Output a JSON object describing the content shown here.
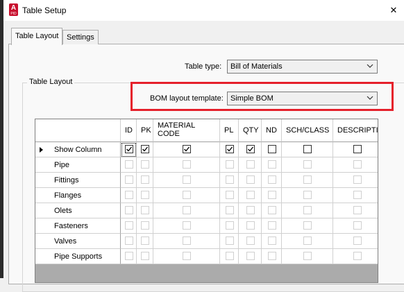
{
  "window": {
    "title": "Table Setup",
    "app_icon_letter": "A",
    "app_icon_sub": "PID"
  },
  "tabs": [
    {
      "label": "Table Layout",
      "active": true
    },
    {
      "label": "Settings",
      "active": false
    }
  ],
  "form": {
    "table_type_label": "Table type:",
    "table_type_value": "Bill of Materials",
    "group_label": "Table Layout",
    "bom_template_label": "BOM layout template:",
    "bom_template_value": "Simple BOM"
  },
  "grid": {
    "columns": [
      "ID",
      "PK",
      "MATERIAL\nCODE",
      "PL",
      "QTY",
      "ND",
      "SCH/CLASS",
      "DESCRIPTI"
    ],
    "rows": [
      {
        "label": "Show Column",
        "current": true,
        "checks": [
          "on",
          "on",
          "on",
          "on",
          "on",
          "blank",
          "blank",
          "blank"
        ]
      },
      {
        "label": "Pipe",
        "current": false,
        "checks": [
          "off",
          "off",
          "off",
          "off",
          "off",
          "off",
          "off",
          "off"
        ]
      },
      {
        "label": "Fittings",
        "current": false,
        "checks": [
          "off",
          "off",
          "off",
          "off",
          "off",
          "off",
          "off",
          "off"
        ]
      },
      {
        "label": "Flanges",
        "current": false,
        "checks": [
          "off",
          "off",
          "off",
          "off",
          "off",
          "off",
          "off",
          "off"
        ]
      },
      {
        "label": "Olets",
        "current": false,
        "checks": [
          "off",
          "off",
          "off",
          "off",
          "off",
          "off",
          "off",
          "off"
        ]
      },
      {
        "label": "Fasteners",
        "current": false,
        "checks": [
          "off",
          "off",
          "off",
          "off",
          "off",
          "off",
          "off",
          "off"
        ]
      },
      {
        "label": "Valves",
        "current": false,
        "checks": [
          "off",
          "off",
          "off",
          "off",
          "off",
          "off",
          "off",
          "off"
        ]
      },
      {
        "label": "Pipe Supports",
        "current": false,
        "checks": [
          "off",
          "off",
          "off",
          "off",
          "off",
          "off",
          "off",
          "off"
        ]
      }
    ]
  },
  "colors": {
    "highlight": "#e5202b",
    "app_icon": "#c8102e"
  }
}
